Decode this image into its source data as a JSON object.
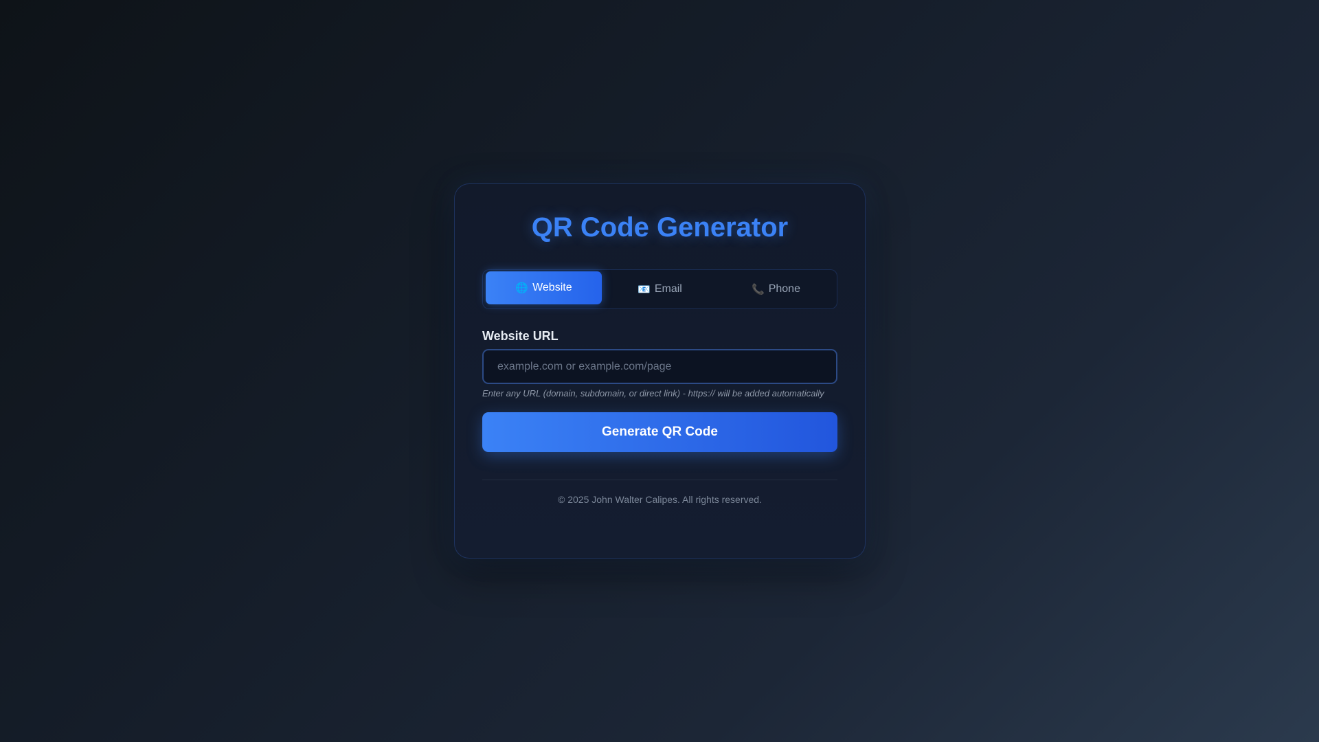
{
  "app": {
    "title": "QR Code Generator"
  },
  "tabs": [
    {
      "label": "Website",
      "icon": "🌐",
      "icon_name": "globe-icon",
      "active": true
    },
    {
      "label": "Email",
      "icon": "📧",
      "icon_name": "email-icon",
      "active": false
    },
    {
      "label": "Phone",
      "icon": "📞",
      "icon_name": "phone-icon",
      "active": false
    }
  ],
  "form": {
    "label": "Website URL",
    "placeholder": "example.com or example.com/page",
    "value": "",
    "hint": "Enter any URL (domain, subdomain, or direct link) - https:// will be added automatically"
  },
  "actions": {
    "generate_label": "Generate QR Code"
  },
  "footer": {
    "text": "© 2025 John Walter Calipes. All rights reserved."
  },
  "colors": {
    "accent": "#3b82f6",
    "accent_dark": "#2563eb",
    "card_bg": "#121a2b"
  }
}
